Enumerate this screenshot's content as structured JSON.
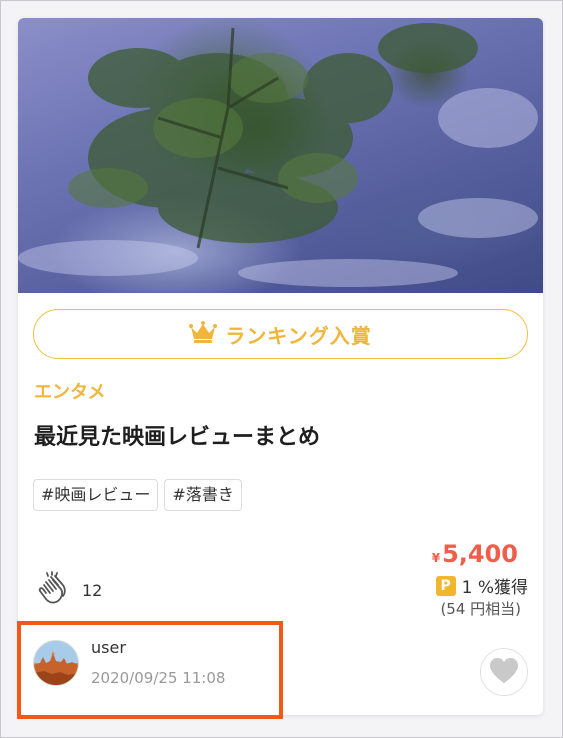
{
  "card": {
    "ranking_label": "ランキング入賞",
    "category": "エンタメ",
    "title": "最近見た映画レビューまとめ",
    "tags": [
      "#映画レビュー",
      "#落書き"
    ],
    "price": {
      "currency_symbol": "¥",
      "amount": "5,400"
    },
    "points": {
      "badge": "P",
      "label": "1 %獲得",
      "equivalent": "(54 円相当)"
    },
    "clap_count": "12",
    "author": {
      "name": "user",
      "date": "2020/09/25 11:08"
    }
  },
  "colors": {
    "accent_gold": "#f0b53a",
    "price_red": "#ee5f4b",
    "highlight_orange": "#f05a16"
  },
  "icons": {
    "ranking": "crown-icon",
    "clap": "clap-icon",
    "like": "heart-icon"
  }
}
